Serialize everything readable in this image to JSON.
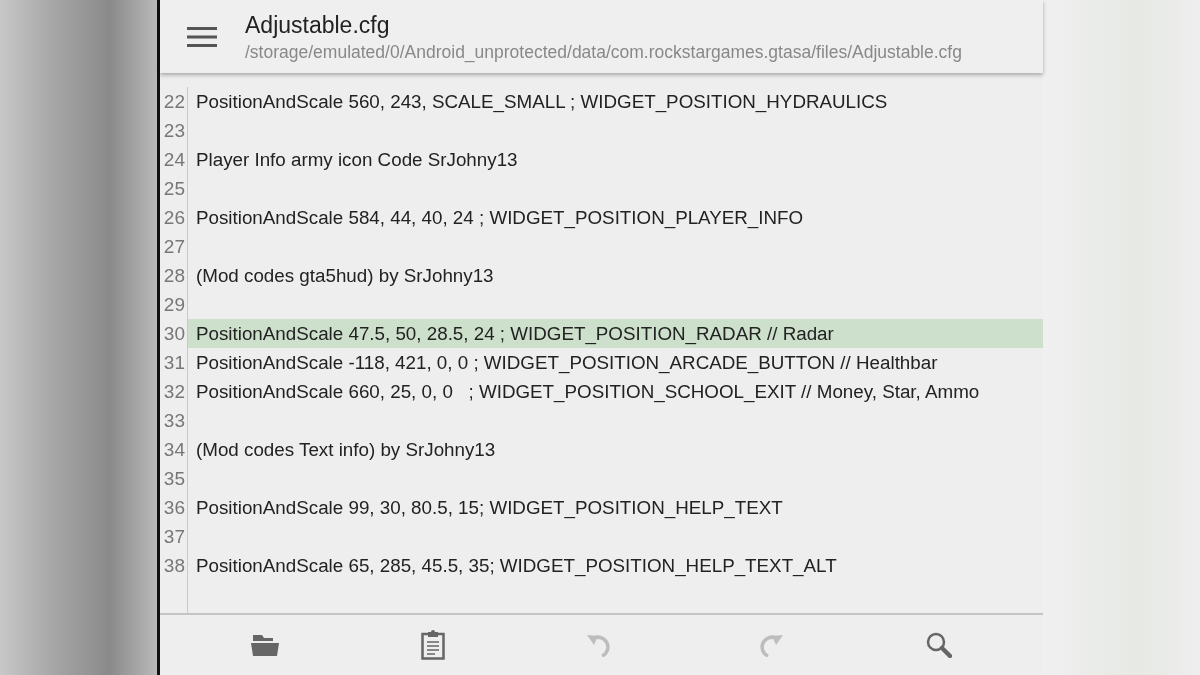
{
  "header": {
    "title": "Adjustable.cfg",
    "path": "/storage/emulated/0/Android_unprotected/data/com.rockstargames.gtasa/files/Adjustable.cfg"
  },
  "lines": [
    {
      "number": "22",
      "text": "PositionAndScale 560, 243, SCALE_SMALL ; WIDGET_POSITION_HYDRAULICS",
      "highlighted": false
    },
    {
      "number": "23",
      "highlighted": false
    },
    {
      "number": "24",
      "text": "Player Info army icon Code SrJohny13",
      "highlighted": false
    },
    {
      "number": "25",
      "highlighted": false
    },
    {
      "number": "26",
      "text": "PositionAndScale 584, 44, 40, 24 ; WIDGET_POSITION_PLAYER_INFO",
      "highlighted": false
    },
    {
      "number": "27",
      "highlighted": false
    },
    {
      "number": "28",
      "text": "(Mod codes gta5hud) by SrJohny13",
      "highlighted": false
    },
    {
      "number": "29",
      "highlighted": false
    },
    {
      "number": "30",
      "text": "PositionAndScale 47.5, 50, 28.5, 24 ; WIDGET_POSITION_RADAR // Radar",
      "highlighted": true
    },
    {
      "number": "31",
      "text": "PositionAndScale -118, 421, 0, 0 ; WIDGET_POSITION_ARCADE_BUTTON // Healthbar",
      "highlighted": false
    },
    {
      "number": "32",
      "text": "PositionAndScale 660, 25, 0, 0   ; WIDGET_POSITION_SCHOOL_EXIT // Money, Star, Ammo",
      "highlighted": false
    },
    {
      "number": "33",
      "highlighted": false
    },
    {
      "number": "34",
      "text": "(Mod codes Text info) by SrJohny13",
      "highlighted": false
    },
    {
      "number": "35",
      "highlighted": false
    },
    {
      "number": "36",
      "text": "PositionAndScale 99, 30, 80.5, 15; WIDGET_POSITION_HELP_TEXT",
      "highlighted": false
    },
    {
      "number": "37",
      "highlighted": false
    },
    {
      "number": "38",
      "text": "PositionAndScale 65, 285, 45.5, 35; WIDGET_POSITION_HELP_TEXT_ALT",
      "highlighted": false
    }
  ],
  "toolbar": [
    {
      "kind": "open",
      "disabled": false
    },
    {
      "kind": "paste",
      "disabled": false
    },
    {
      "kind": "undo",
      "disabled": true
    },
    {
      "kind": "redo",
      "disabled": true
    },
    {
      "kind": "search",
      "disabled": false
    }
  ]
}
